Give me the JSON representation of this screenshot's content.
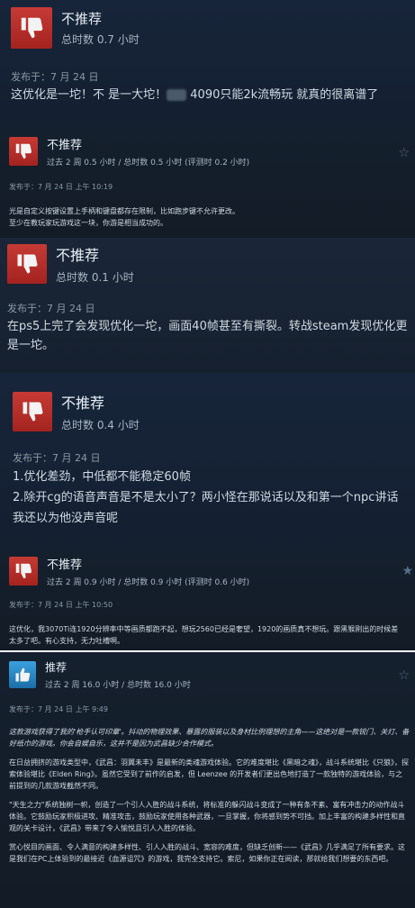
{
  "reviews": [
    {
      "verdict": "不推荐",
      "hours": "总时数 0.7 小时",
      "posted": "发布于：7 月 24 日",
      "text_a": "这优化是一坨！不 是一大坨！",
      "text_b": " 4090只能2k流畅玩 就真的很离谱了",
      "icon": "thumbs-down-icon",
      "icon_color": "#b02c27"
    },
    {
      "verdict": "不推荐",
      "hours": "过去 2 周 0.5 小时 / 总时数 0.5 小时  (评测时 0.2 小时)",
      "posted": "发布于：7 月 24 日 上午 10:19",
      "text": "光是自定义按键设置上手柄和键盘都存在限制，比如跑步键不允许更改。\n至少在教玩家玩游戏这一块，你游是相当成功的。",
      "icon": "thumbs-down-icon"
    },
    {
      "verdict": "不推荐",
      "hours": "总时数 0.1 小时",
      "posted": "发布于：7 月 24 日",
      "text": "在ps5上完了会发现优化一坨，画面40帧甚至有撕裂。转战steam发现优化更是一坨。",
      "icon": "thumbs-down-icon"
    },
    {
      "verdict": "不推荐",
      "hours": "总时数 0.4 小时",
      "posted": "发布于：7 月 24 日",
      "text": "1.优化差劲，中低都不能稳定60帧\n2.除开cg的语音声音是不是太小了？两小怪在那说话以及和第一个npc讲话我还以为他没声音呢",
      "icon": "thumbs-down-icon"
    },
    {
      "verdict": "不推荐",
      "hours": "过去 2 周 0.9 小时 / 总时数 0.9 小时  (评测时 0.6 小时)",
      "posted": "发布于：7 月 24 日 上午 10:50",
      "text": "这优化，我3070Ti连1920分辨率中等画质都跑不起，想玩2560已经是奢望，1920的画质真不想玩。跟黑猴刚出的时候差太多了吧。有心支持，无力吐槽啊。",
      "icon": "thumbs-down-icon"
    },
    {
      "verdict": "推荐",
      "hours": "过去 2 周 16.0 小时 / 总时数 16.0 小时",
      "posted": "发布于：7 月 24 日 上午 9:49",
      "paragraphs": [
        "这款游戏获得了我的'枪手认可印章'。抖动的物理效果、暴露的服装以及身材比例理想的主角——这绝对是一款锐门、关灯、备好纸巾的游戏。你会自娱自乐，这并不是因为武昌缺少合作模式。",
        "在日益拥挤的游戏类型中，《武昌：羽翼未丰》是最新的类魂游戏体验。它的难度堪比《黑暗之魂》，战斗系统堪比《只狼》，探索体验堪比《Elden Ring》。虽然它受到了前作的启发，但 Leenzee 的开发者们更出色地打造了一款独特的游戏体验，与之前提到的几款游戏截然不同。",
        "\"天生之力\"系统独树一帜，创造了一个引人入胜的战斗系统，将标准的躲闪战斗变成了一种有条不紊、富有冲击力的动作战斗体验。它鼓励玩家积极进攻、精准攻击，鼓励玩家使用各种武器，一旦掌握，你将感到势不可挡。加上丰富的构建多样性和直观的关卡设计，《武昌》带来了令人愉悦且引人入胜的体验。",
        "赏心悦目的画面、令人满意的构建多样性、引人入胜的战斗、宽容的难度，但缺乏创新——《武昌》几乎满足了所有要求。这是我们在PC上体验到的最接近《血源诅咒》的游戏，我完全支持它。索尼，如果你正在阅读，那就给我们想要的东西吧。"
      ],
      "icon": "thumbs-up-icon",
      "icon_color": "#2a86c7"
    }
  ]
}
